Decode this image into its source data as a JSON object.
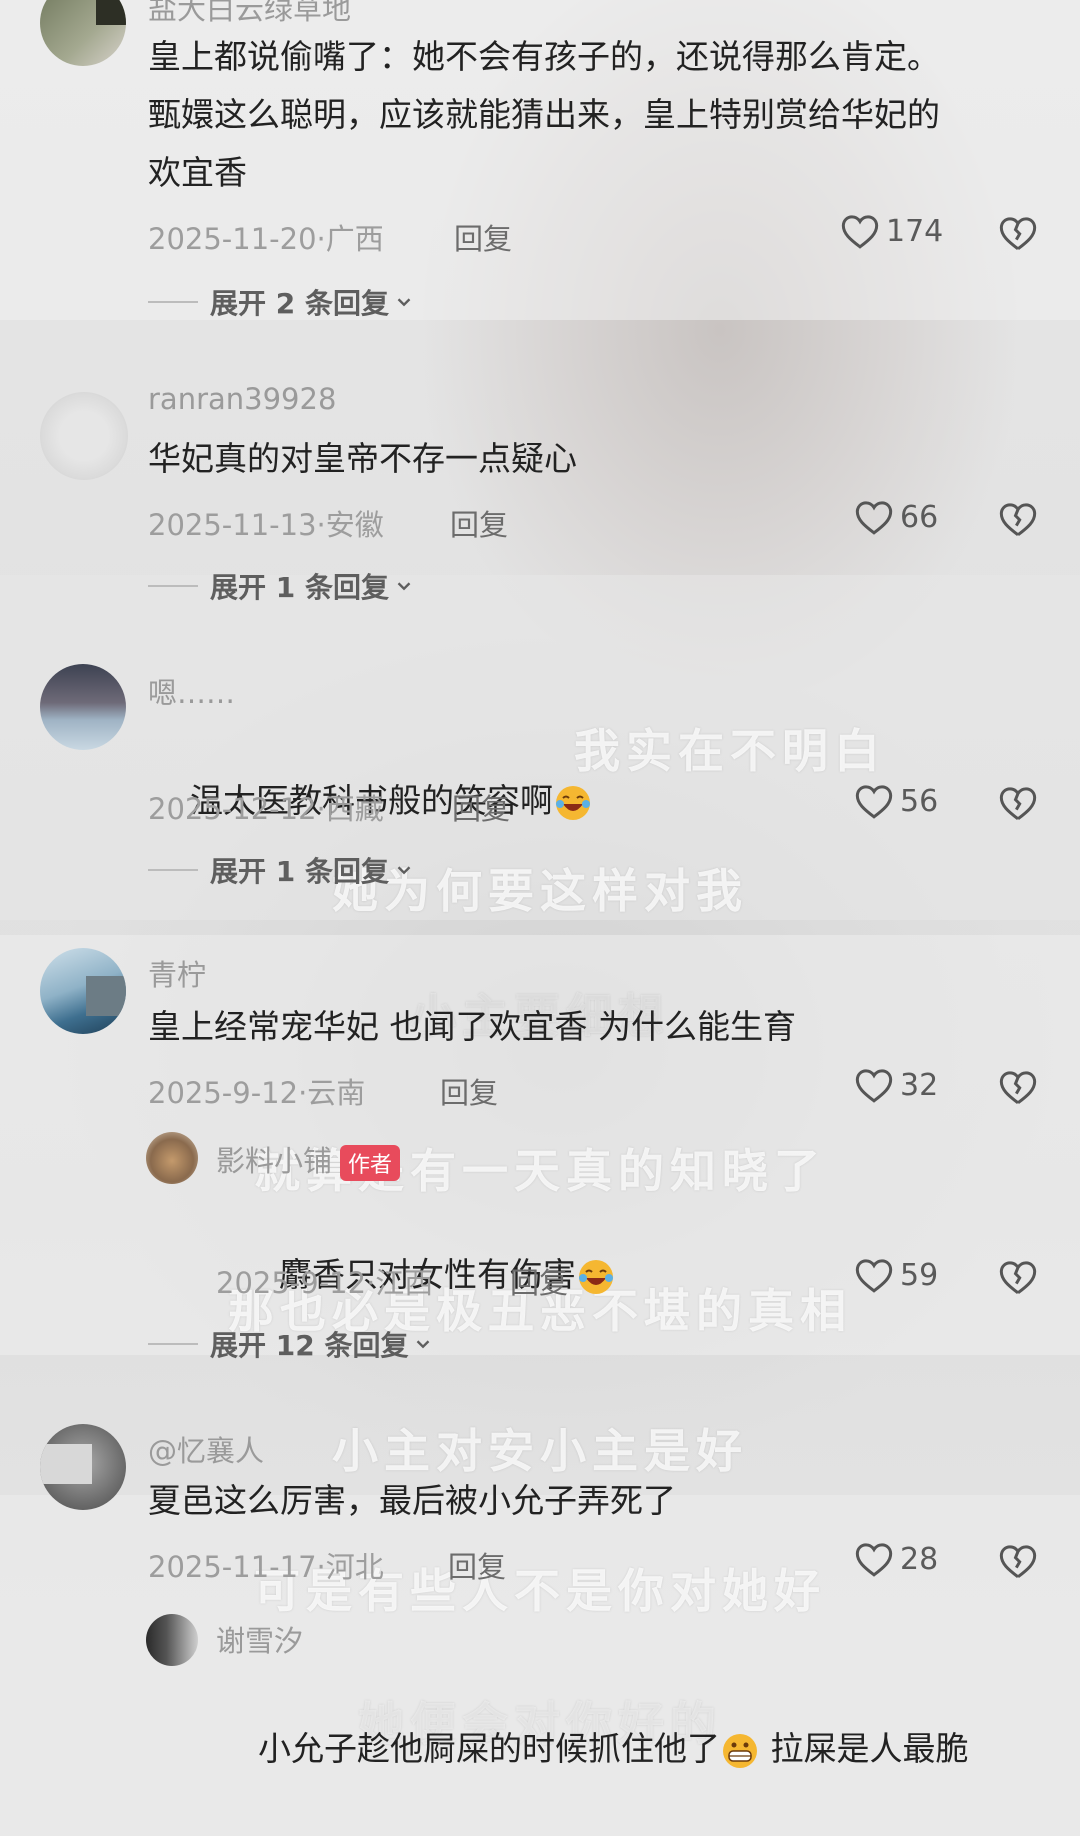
{
  "subtitles": [
    "我实在不明白",
    "她为何要这样对我",
    "小主要细想",
    "就算是有一天真的知晓了",
    "那也必是极丑恶不堪的真相",
    "小主对安小主是好",
    "可是有些人不是你对她好",
    "她便会对你好的"
  ],
  "colors": {
    "badge": "#e84b5c",
    "text": "#222222",
    "meta": "#9d9d9d"
  },
  "comments": [
    {
      "username": "盐大白云绿草地",
      "text": "皇上都说偷嘴了：她不会有孩子的，还说得那么肯定。甄嬛这么聪明，应该就能猜出来，皇上特别赏给华妃的欢宜香",
      "line1": "皇上都说偷嘴了：她不会有孩子的，还说得那么肯定。",
      "line2": "甄嬛这么聪明，应该就能猜出来，皇上特别赏给华妃的",
      "line3": "欢宜香",
      "date_location": "2025-11-20·广西",
      "reply_label": "回复",
      "likes": "174",
      "expand_label": "展开 2 条回复"
    },
    {
      "username": "ranran39928",
      "text": "华妃真的对皇帝不存一点疑心",
      "date_location": "2025-11-13·安徽",
      "reply_label": "回复",
      "likes": "66",
      "expand_label": "展开 1 条回复"
    },
    {
      "username": "嗯……",
      "text": "温太医教科书般的笑容啊",
      "emoji": "laughing-crying-emoji",
      "date_location": "2025-12-12·西藏",
      "reply_label": "回复",
      "likes": "56",
      "expand_label": "展开 1 条回复"
    },
    {
      "username": "青柠",
      "text": "皇上经常宠华妃 也闻了欢宜香 为什么能生育",
      "date_location": "2025-9-12·云南",
      "reply_label": "回复",
      "likes": "32",
      "sub_reply": {
        "username": "影料小铺",
        "badge": "作者",
        "text": "麝香只对女性有伤害",
        "emoji": "laughing-crying-emoji",
        "date_location": "2025-9-12·江西",
        "reply_label": "回复",
        "likes": "59"
      },
      "expand_label": "展开 12 条回复"
    },
    {
      "username": "@忆襄人",
      "text": "夏邑这么厉害，最后被小允子弄死了",
      "date_location": "2025-11-17·河北",
      "reply_label": "回复",
      "likes": "28"
    },
    {
      "username": "谢雪汐",
      "text_part1": "小允子趁他屙屎的时候抓住他了",
      "emoji": "grinning-emoji",
      "text_part2": " 拉屎是人最脆"
    }
  ]
}
